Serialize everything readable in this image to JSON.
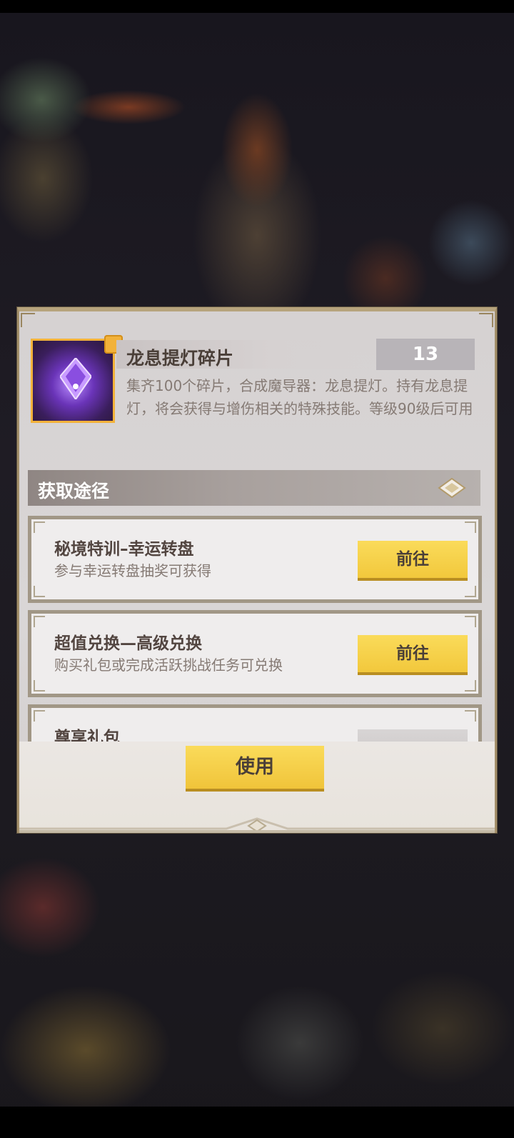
{
  "item": {
    "name": "龙息提灯碎片",
    "count": "13",
    "description": "集齐100个碎片，合成魔导器：龙息提灯。持有龙息提灯，将会获得与增伤相关的特殊技能。等级90级后可用",
    "icon": "dragon-lantern-shard-icon"
  },
  "section": {
    "title": "获取途径"
  },
  "sources": [
    {
      "title": "秘境特训–幸运转盘",
      "subtitle": "参与幸运转盘抽奖可获得",
      "button": "前往"
    },
    {
      "title": "超值兑换—高级兑换",
      "subtitle": "购买礼包或完成活跃挑战任务可兑换",
      "button": "前往"
    },
    {
      "title": "尊享礼包",
      "subtitle": "",
      "button": ""
    }
  ],
  "use_button": "使用",
  "colors": {
    "accent_yellow": "#f2c83c",
    "item_border": "#f2b23a",
    "panel_bg": "#d8d4d4"
  }
}
